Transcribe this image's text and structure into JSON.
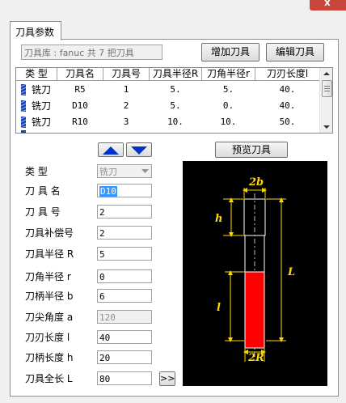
{
  "window": {
    "close_glyph": "x"
  },
  "tab": {
    "label": "刀具参数"
  },
  "library": {
    "text": "刀具库 :  fanuc   共 7 把刀具"
  },
  "buttons": {
    "add_tool": "增加刀具",
    "edit_tool": "编辑刀具",
    "preview_tool": "预览刀具",
    "expand": ">>"
  },
  "table": {
    "columns": [
      "类 型",
      "刀具名",
      "刀具号",
      "刀具半径R",
      "刀角半径r",
      "刀刃长度l"
    ],
    "rows": [
      {
        "type": "铣刀",
        "name": "R5",
        "number": "1",
        "radius": "5.",
        "corner": "5.",
        "length": "40."
      },
      {
        "type": "铣刀",
        "name": "D10",
        "number": "2",
        "radius": "5.",
        "corner": "0.",
        "length": "40."
      },
      {
        "type": "铣刀",
        "name": "R10",
        "number": "3",
        "radius": "10.",
        "corner": "10.",
        "length": "50."
      }
    ]
  },
  "form": {
    "type_label": "类       型",
    "type_value": "铣刀",
    "name_label": "刀 具 名",
    "name_value": "D10",
    "number_label": "刀 具 号",
    "number_value": "2",
    "comp_label": "刀具补偿号",
    "comp_value": "2",
    "radius_label": "刀具半径 R",
    "radius_value": "5",
    "corner_label": "刀角半径 r",
    "corner_value": "0",
    "shank_radius_label": "刀柄半径 b",
    "shank_radius_value": "6",
    "tip_angle_label": "刀尖角度 a",
    "tip_angle_value": "120",
    "blade_length_label": "刀刃长度 l",
    "blade_length_value": "40",
    "shank_length_label": "刀柄长度 h",
    "shank_length_value": "20",
    "total_length_label": "刀具全长 L",
    "total_length_value": "80"
  },
  "diagram": {
    "label_2b": "2b",
    "label_h": "h",
    "label_L": "L",
    "label_l": "l",
    "label_2R": "2R"
  },
  "colors": {
    "diagram_bg": "#000000",
    "blade": "#ff0000",
    "dimension": "#ffd800",
    "arrow_blue": "#0033cc"
  }
}
